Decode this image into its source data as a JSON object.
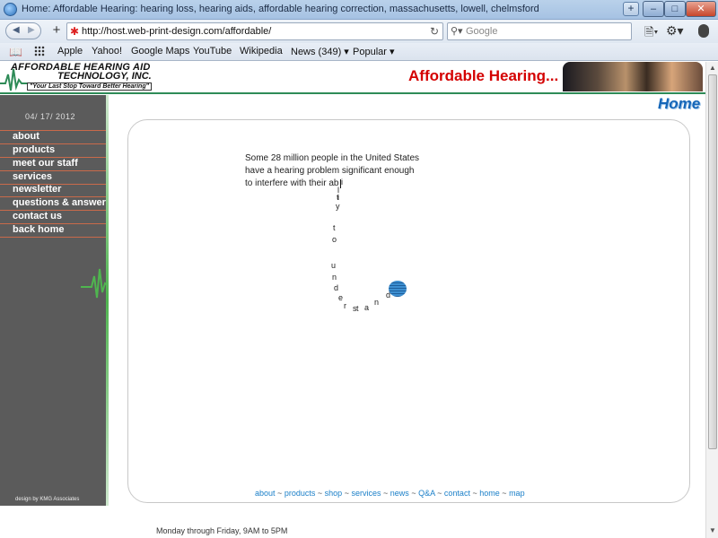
{
  "browser": {
    "window_title": "Home: Affordable Hearing: hearing loss, hearing aids, affordable hearing correction, massachusetts, lowell, chelmsford",
    "new_tab": "+",
    "url": "http://host.web-print-design.com/affordable/",
    "search_placeholder": "Google",
    "bookmarks": [
      "Apple",
      "Yahoo!",
      "Google Maps",
      "YouTube",
      "Wikipedia",
      "News (349) ▾",
      "Popular ▾"
    ]
  },
  "header": {
    "logo_line1": "AFFORDABLE HEARING AID",
    "logo_line2": "TECHNOLOGY, INC.",
    "logo_tagline": "\"Your Last Stop Toward Better Hearing\"",
    "site_title": "Affordable Hearing...",
    "page_label": "Home"
  },
  "sidebar": {
    "date": "04/ 17/ 2012",
    "items": [
      "about",
      "products",
      "meet our staff",
      "services",
      "newsletter",
      "questions & answers",
      "contact us",
      "back home"
    ],
    "credit": "design by KMG Associates"
  },
  "content": {
    "intro_lines": [
      "Some 28 million people in the United States",
      "have a hearing problem significant enough",
      "to interfere with their ab"
    ],
    "animated_letters": [
      "i",
      "l",
      "i",
      "t",
      "y",
      "t",
      "o",
      "u",
      "n",
      "d",
      "e",
      "r",
      "s",
      "t",
      "a",
      "n",
      "d"
    ]
  },
  "footer": {
    "links": [
      "about",
      "products",
      "shop",
      "services",
      "news",
      "Q&A",
      "contact",
      "home",
      "map"
    ],
    "separators": [
      "~",
      "~",
      "~",
      "~",
      "~",
      "~",
      "~",
      "~"
    ],
    "hours": "Monday through Friday, 9AM to 5PM"
  },
  "colors": {
    "accent_red": "#d40000",
    "link_blue": "#1a7fc8",
    "sidebar_gray": "#5b5b5b",
    "rule_green": "#2e8b57"
  }
}
